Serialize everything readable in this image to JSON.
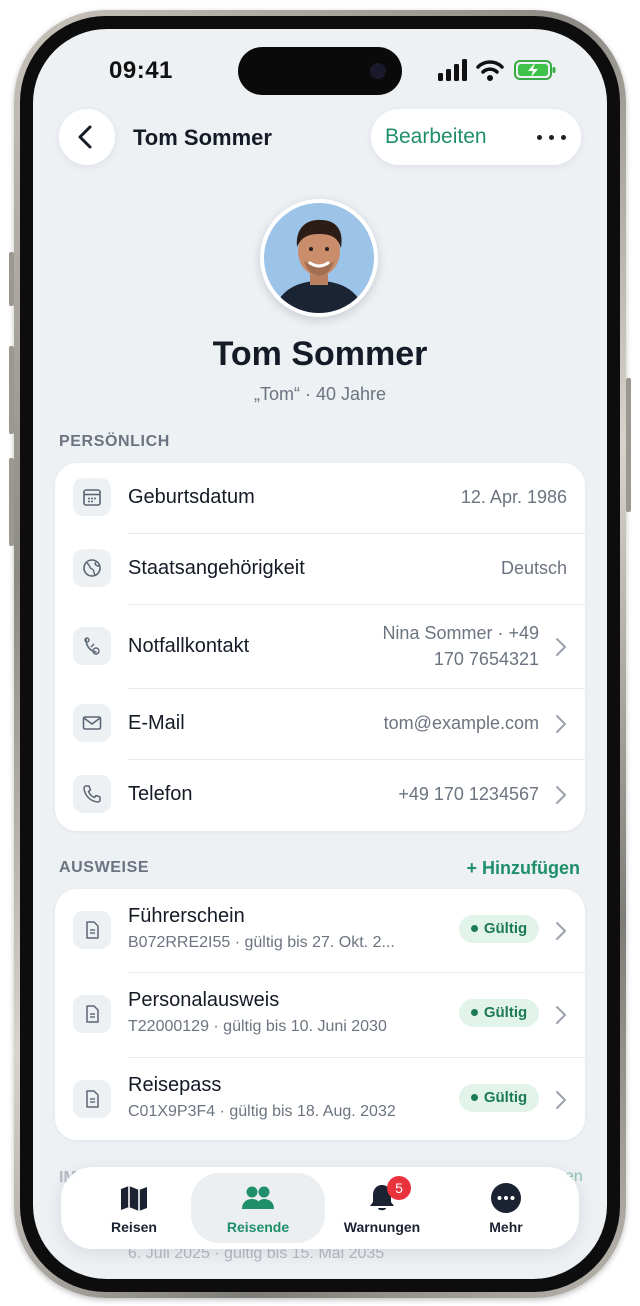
{
  "status_bar": {
    "time": "09:41"
  },
  "nav": {
    "title": "Tom Sommer",
    "edit_label": "Bearbeiten"
  },
  "profile": {
    "name": "Tom Sommer",
    "subtitle": "„Tom“ · 40 Jahre"
  },
  "personal": {
    "section_label": "PERSÖNLICH",
    "rows": [
      {
        "icon": "calendar-icon",
        "label": "Geburtsdatum",
        "value": "12. Apr. 1986"
      },
      {
        "icon": "globe-icon",
        "label": "Staatsangehörigkeit",
        "value": "Deutsch"
      },
      {
        "icon": "emergency-contact-icon",
        "label": "Notfallkontakt",
        "value_line1": "Nina Sommer · +49",
        "value_line2": "170 7654321"
      },
      {
        "icon": "mail-icon",
        "label": "E-Mail",
        "value": "tom@example.com"
      },
      {
        "icon": "phone-icon",
        "label": "Telefon",
        "value": "+49 170 1234567"
      }
    ]
  },
  "ids": {
    "section_label": "AUSWEISE",
    "add_label": "+ Hinzufügen",
    "items": [
      {
        "icon": "document-icon",
        "title": "Führerschein",
        "subtitle": "B072RRE2I55 · gültig bis 27. Okt. 2...",
        "status": "Gültig"
      },
      {
        "icon": "document-icon",
        "title": "Personalausweis",
        "subtitle": "T22000129 · gültig bis 10. Juni 2030",
        "status": "Gültig"
      },
      {
        "icon": "document-icon",
        "title": "Reisepass",
        "subtitle": "C01X9P3F4 · gültig bis 18. Aug. 2032",
        "status": "Gültig"
      }
    ]
  },
  "hidden_section": {
    "label_fragment": "IM",
    "action_fragment": "en",
    "row_sub_fragment": "6. Juli 2025 · gültig bis 15. Mai 2035"
  },
  "tabbar": {
    "tabs": [
      {
        "label": "Reisen",
        "icon": "map-icon",
        "active": false
      },
      {
        "label": "Reisende",
        "icon": "people-icon",
        "active": true
      },
      {
        "label": "Warnungen",
        "icon": "bell-icon",
        "active": false,
        "badge": "5"
      },
      {
        "label": "Mehr",
        "icon": "more-icon",
        "active": false
      }
    ]
  },
  "colors": {
    "accent": "#1f8f69",
    "badge_bg": "#e2f3ea",
    "alert": "#e8323c",
    "screen_bg": "#eef1f4"
  }
}
